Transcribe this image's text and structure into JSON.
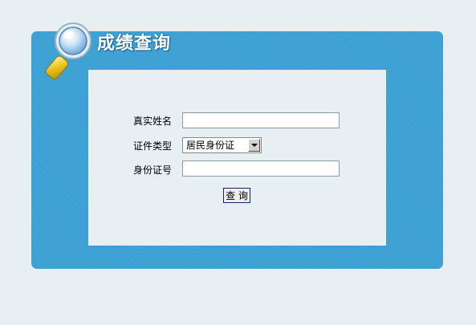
{
  "header": {
    "title": "成绩查询"
  },
  "form": {
    "name_label": "真实姓名",
    "name_value": "",
    "id_type_label": "证件类型",
    "id_type_selected": "居民身份证",
    "id_number_label": "身份证号",
    "id_number_value": "",
    "submit_label": "查 询"
  },
  "icons": {
    "title_icon": "magnifier-icon",
    "select_arrow": "chevron-down-icon"
  },
  "colors": {
    "page_background": "#e8eff2",
    "panel_blue": "#3a9fd3",
    "button_border": "#10246b"
  }
}
